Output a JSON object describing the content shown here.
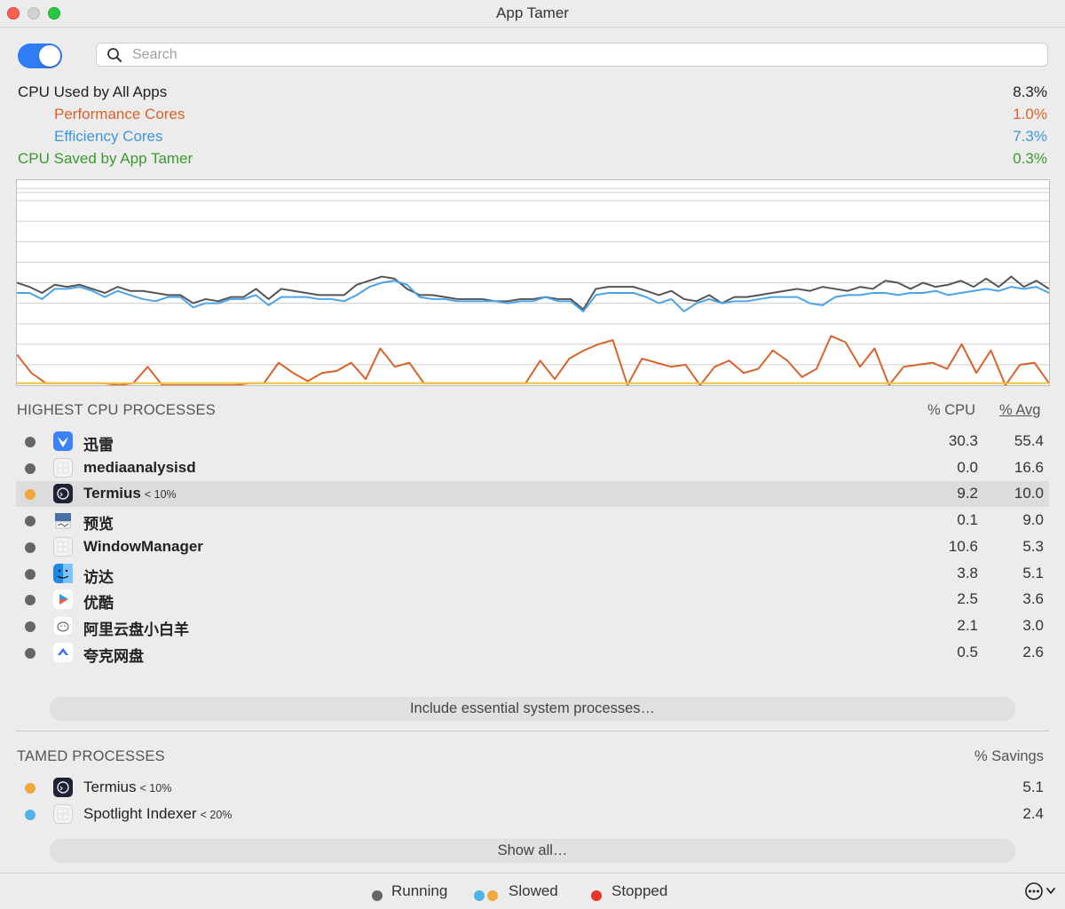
{
  "window": {
    "title": "App Tamer"
  },
  "search": {
    "placeholder": "Search"
  },
  "stats": {
    "cpu_all": {
      "label": "CPU Used by All Apps",
      "value": "8.3%"
    },
    "perf": {
      "label": "Performance Cores",
      "value": "1.0%"
    },
    "eff": {
      "label": "Efficiency Cores",
      "value": "7.3%"
    },
    "saved": {
      "label": "CPU Saved by App Tamer",
      "value": "0.3%"
    }
  },
  "colors": {
    "total_line": "#555555",
    "efficiency": "#4aa3e6",
    "performance": "#d9622b",
    "saved": "#f0c33c",
    "saved_text": "#3a9a2c",
    "perf_text": "#d9622b",
    "eff_text": "#3f96dc",
    "running_dot": "#666666",
    "slowed_blue": "#4fb3e8",
    "slowed_orange": "#f2a93b",
    "stopped_dot": "#e8362b"
  },
  "highest": {
    "heading": "HIGHEST CPU PROCESSES",
    "col_cpu": "% CPU",
    "col_avg": "% Avg",
    "rows": [
      {
        "name": "迅雷",
        "tag": "",
        "cpu": "30.3",
        "avg": "55.4",
        "status": "running",
        "icon": "xunlei-icon"
      },
      {
        "name": "mediaanalysisd",
        "tag": "",
        "cpu": "0.0",
        "avg": "16.6",
        "status": "running",
        "icon": "generic-app-icon"
      },
      {
        "name": "Termius",
        "tag": "< 10%",
        "cpu": "9.2",
        "avg": "10.0",
        "status": "slowed",
        "icon": "termius-icon"
      },
      {
        "name": "预览",
        "tag": "",
        "cpu": "0.1",
        "avg": "9.0",
        "status": "running",
        "icon": "preview-icon"
      },
      {
        "name": "WindowManager",
        "tag": "",
        "cpu": "10.6",
        "avg": "5.3",
        "status": "running",
        "icon": "generic-app-icon"
      },
      {
        "name": "访达",
        "tag": "",
        "cpu": "3.8",
        "avg": "5.1",
        "status": "running",
        "icon": "finder-icon"
      },
      {
        "name": "优酷",
        "tag": "",
        "cpu": "2.5",
        "avg": "3.6",
        "status": "running",
        "icon": "youku-icon"
      },
      {
        "name": "阿里云盘小白羊",
        "tag": "",
        "cpu": "2.1",
        "avg": "3.0",
        "status": "running",
        "icon": "sheep-icon"
      },
      {
        "name": "夸克网盘",
        "tag": "",
        "cpu": "0.5",
        "avg": "2.6",
        "status": "running",
        "icon": "quark-icon"
      }
    ],
    "include_button": "Include essential system processes…"
  },
  "tamed": {
    "heading": "TAMED PROCESSES",
    "col_savings": "% Savings",
    "rows": [
      {
        "name": "Termius",
        "tag": "< 10%",
        "savings": "5.1",
        "status": "slowed",
        "icon": "termius-icon"
      },
      {
        "name": "Spotlight Indexer",
        "tag": "< 20%",
        "savings": "2.4",
        "status": "slowed-blue",
        "icon": "generic-app-icon"
      }
    ],
    "show_all_button": "Show all…"
  },
  "legend": {
    "running": "Running",
    "slowed": "Slowed",
    "stopped": "Stopped"
  },
  "chart_data": {
    "type": "line",
    "ylim": [
      0,
      100
    ],
    "series": [
      {
        "values": [
          50,
          48,
          45,
          49,
          48,
          49,
          47,
          45,
          48,
          46,
          46,
          45,
          44,
          44,
          40,
          42,
          41,
          43,
          43,
          47,
          42,
          47,
          46,
          45,
          44,
          44,
          44,
          49,
          51,
          53,
          52,
          47,
          44,
          44,
          43,
          42,
          42,
          42,
          41,
          41,
          42,
          42,
          43,
          42,
          42,
          37,
          47,
          48,
          48,
          48,
          46,
          44,
          46,
          42,
          41,
          44,
          40,
          43,
          43,
          44,
          45,
          46,
          47,
          46,
          48,
          47,
          46,
          48,
          47,
          51,
          50,
          47,
          50,
          48,
          49,
          51,
          48,
          52,
          48,
          53,
          48,
          51,
          47
        ]
      },
      {
        "values": [
          45,
          45,
          42,
          47,
          47,
          48,
          46,
          43,
          46,
          44,
          42,
          41,
          43,
          43,
          38,
          40,
          40,
          42,
          42,
          44,
          39,
          43,
          43,
          43,
          42,
          42,
          41,
          44,
          48,
          50,
          51,
          49,
          43,
          42,
          42,
          41,
          41,
          41,
          41,
          40,
          41,
          41,
          43,
          41,
          41,
          36,
          44,
          45,
          45,
          45,
          43,
          40,
          42,
          36,
          40,
          42,
          40,
          41,
          41,
          42,
          43,
          43,
          43,
          40,
          39,
          43,
          44,
          44,
          45,
          45,
          44,
          45,
          45,
          46,
          44,
          45,
          46,
          47,
          46,
          48,
          47,
          48,
          45
        ]
      },
      {
        "values": [
          15,
          6,
          1,
          1,
          1,
          1,
          1,
          0,
          1,
          9,
          0,
          0,
          0,
          0,
          0,
          0,
          1,
          1,
          11,
          6,
          2,
          6,
          7,
          11,
          3,
          18,
          9,
          11,
          1,
          1,
          1,
          1,
          1,
          1,
          1,
          1,
          12,
          3,
          13,
          17,
          20,
          22,
          0,
          13,
          11,
          9,
          10,
          0,
          9,
          12,
          6,
          8,
          17,
          12,
          4,
          8,
          24,
          21,
          9,
          18,
          0,
          9,
          10,
          11,
          8,
          20,
          6,
          17,
          0,
          10,
          11,
          1
        ]
      },
      {
        "values": [
          1,
          1,
          1,
          1,
          1,
          1,
          1,
          1,
          1,
          1,
          1,
          1,
          1,
          1,
          1,
          1,
          1,
          1,
          1,
          1,
          1,
          1,
          1,
          1,
          1,
          1,
          1,
          1,
          1,
          1,
          1,
          1,
          1,
          1,
          1,
          1,
          1,
          1,
          1,
          1,
          1,
          1,
          1,
          1,
          1,
          1,
          1,
          1,
          1,
          1,
          1,
          1,
          1,
          1,
          1,
          1,
          1,
          1,
          1,
          1,
          1,
          1,
          1,
          1,
          1,
          1,
          1,
          1,
          1,
          1,
          1,
          1,
          1,
          1,
          1,
          1,
          1,
          1,
          1,
          1,
          1,
          1,
          1
        ]
      }
    ]
  }
}
